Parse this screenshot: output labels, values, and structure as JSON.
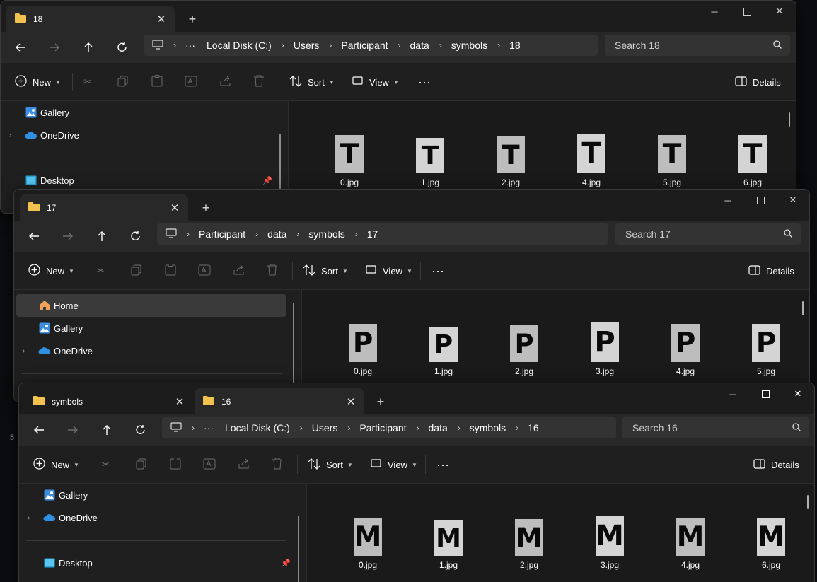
{
  "windows": [
    {
      "tabs": [
        {
          "title": "18"
        }
      ],
      "breadcrumbs": [
        "Local Disk (C:)",
        "Users",
        "Participant",
        "data",
        "symbols",
        "18"
      ],
      "search_placeholder": "Search 18",
      "toolbar": {
        "new": "New",
        "sort": "Sort",
        "view": "View",
        "details": "Details"
      },
      "nav": [
        {
          "label": "Gallery",
          "icon": "gallery-icon"
        },
        {
          "label": "OneDrive",
          "icon": "onedrive-icon"
        },
        {
          "label": "Desktop",
          "icon": "desktop-icon"
        }
      ],
      "glyph": "T",
      "files": [
        "0.jpg",
        "1.jpg",
        "2.jpg",
        "4.jpg",
        "5.jpg",
        "6.jpg"
      ]
    },
    {
      "tabs": [
        {
          "title": "17"
        }
      ],
      "breadcrumbs": [
        "Participant",
        "data",
        "symbols",
        "17"
      ],
      "search_placeholder": "Search 17",
      "toolbar": {
        "new": "New",
        "sort": "Sort",
        "view": "View",
        "details": "Details"
      },
      "nav": [
        {
          "label": "Home",
          "icon": "home-icon"
        },
        {
          "label": "Gallery",
          "icon": "gallery-icon"
        },
        {
          "label": "OneDrive",
          "icon": "onedrive-icon"
        }
      ],
      "glyph": "P",
      "files": [
        "0.jpg",
        "1.jpg",
        "2.jpg",
        "3.jpg",
        "4.jpg",
        "5.jpg"
      ]
    },
    {
      "tabs": [
        {
          "title": "symbols"
        },
        {
          "title": "16"
        }
      ],
      "breadcrumbs": [
        "Local Disk (C:)",
        "Users",
        "Participant",
        "data",
        "symbols",
        "16"
      ],
      "search_placeholder": "Search 16",
      "toolbar": {
        "new": "New",
        "sort": "Sort",
        "view": "View",
        "details": "Details"
      },
      "nav": [
        {
          "label": "Gallery",
          "icon": "gallery-icon"
        },
        {
          "label": "OneDrive",
          "icon": "onedrive-icon"
        },
        {
          "label": "Desktop",
          "icon": "desktop-icon"
        }
      ],
      "glyph": "M",
      "files": [
        "0.jpg",
        "1.jpg",
        "2.jpg",
        "3.jpg",
        "4.jpg",
        "6.jpg"
      ]
    }
  ],
  "colors": {
    "folder": "#f2c14e",
    "onedrive": "#2f8fe0",
    "home": "#f0a25a"
  }
}
